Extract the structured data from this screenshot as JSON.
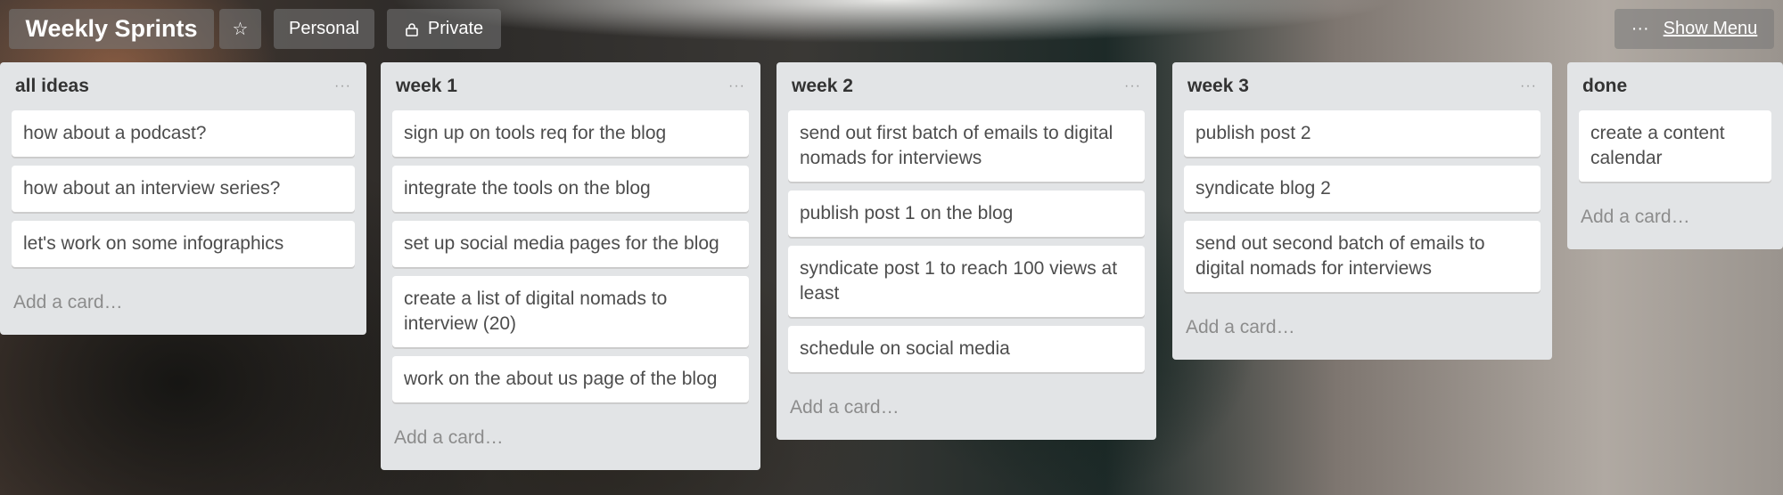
{
  "header": {
    "title": "Weekly Sprints",
    "star_icon": "☆",
    "personal": "Personal",
    "private_icon": "lock-icon",
    "private": "Private",
    "menu_icon": "···",
    "show_menu": "Show Menu"
  },
  "add_card_label": "Add a card…",
  "lists": [
    {
      "name": "all ideas",
      "cards": [
        "how about a podcast?",
        "how about an interview series?",
        "let's work on some infographics"
      ]
    },
    {
      "name": "week 1",
      "cards": [
        "sign up on tools req for the blog",
        "integrate the tools on the blog",
        "set up social media pages for the blog",
        "create a list of digital nomads to interview (20)",
        "work on the about us page of the blog"
      ]
    },
    {
      "name": "week 2",
      "cards": [
        "send out first batch of emails to digital nomads for interviews",
        "publish post 1 on the blog",
        "syndicate post 1 to reach 100 views at least",
        "schedule on social media"
      ]
    },
    {
      "name": "week 3",
      "cards": [
        "publish post 2",
        "syndicate blog 2",
        "send out second batch of emails to digital nomads for interviews"
      ]
    },
    {
      "name": "done",
      "cards": [
        "create a content calendar"
      ]
    }
  ]
}
